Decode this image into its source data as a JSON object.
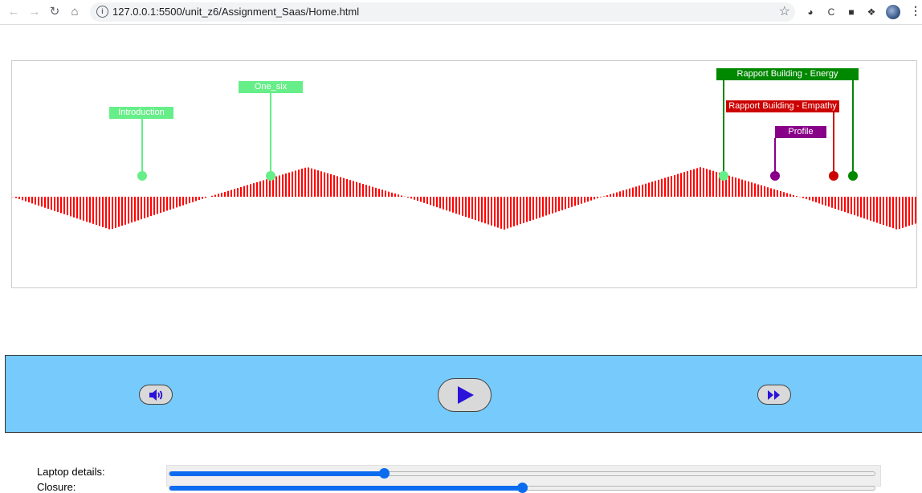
{
  "browser": {
    "url": "127.0.0.1:5500/unit_z6/Assignment_Saas/Home.html",
    "back_icon": "arrow-left-icon",
    "forward_icon": "arrow-right-icon",
    "reload_icon": "reload-icon",
    "home_icon": "home-icon",
    "extensions": [
      "ext-icon-1",
      "ext-icon-2",
      "ext-icon-3",
      "puzzle-icon"
    ]
  },
  "timeline": {
    "waveform_color": "#ff0000",
    "markers": [
      {
        "label": "Introduction",
        "color": "#66ee88"
      },
      {
        "label": "One_six",
        "color": "#66ee88"
      },
      {
        "label": "Rapport Building - Energy",
        "color": "#008800"
      },
      {
        "label": "Rapport Building - Empathy",
        "color": "#cc0000"
      },
      {
        "label": "Profile",
        "color": "#880088"
      }
    ]
  },
  "player": {
    "background": "#76cafc",
    "volume_icon": "volume-icon",
    "play_icon": "play-icon",
    "fast_forward_icon": "fast-forward-icon"
  },
  "sliders": [
    {
      "label": "Laptop details:",
      "value": 0.304
    },
    {
      "label": "Closure:",
      "value": 0.5
    }
  ]
}
